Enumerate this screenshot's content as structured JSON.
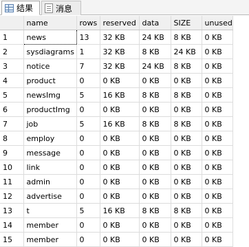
{
  "tabs": [
    {
      "label": "结果",
      "icon": "grid-icon"
    },
    {
      "label": "消息",
      "icon": "document-icon"
    }
  ],
  "columns": [
    "",
    "name",
    "rows",
    "reserved",
    "data",
    "SIZE",
    "unused"
  ],
  "rows": [
    [
      "1",
      "news",
      "13",
      "32 KB",
      "24 KB",
      "8 KB",
      "0 KB"
    ],
    [
      "2",
      "sysdiagrams",
      "1",
      "32 KB",
      "8 KB",
      "24 KB",
      "0 KB"
    ],
    [
      "3",
      "notice",
      "7",
      "32 KB",
      "24 KB",
      "8 KB",
      "0 KB"
    ],
    [
      "4",
      "product",
      "0",
      "0 KB",
      "0 KB",
      "0 KB",
      "0 KB"
    ],
    [
      "5",
      "newsImg",
      "5",
      "16 KB",
      "8 KB",
      "8 KB",
      "0 KB"
    ],
    [
      "6",
      "productImg",
      "0",
      "0 KB",
      "0 KB",
      "0 KB",
      "0 KB"
    ],
    [
      "7",
      "job",
      "5",
      "16 KB",
      "8 KB",
      "8 KB",
      "0 KB"
    ],
    [
      "8",
      "employ",
      "0",
      "0 KB",
      "0 KB",
      "0 KB",
      "0 KB"
    ],
    [
      "9",
      "message",
      "0",
      "0 KB",
      "0 KB",
      "0 KB",
      "0 KB"
    ],
    [
      "10",
      "link",
      "0",
      "0 KB",
      "0 KB",
      "0 KB",
      "0 KB"
    ],
    [
      "11",
      "admin",
      "0",
      "0 KB",
      "0 KB",
      "0 KB",
      "0 KB"
    ],
    [
      "12",
      "advertise",
      "0",
      "0 KB",
      "0 KB",
      "0 KB",
      "0 KB"
    ],
    [
      "13",
      "t",
      "5",
      "16 KB",
      "8 KB",
      "8 KB",
      "0 KB"
    ],
    [
      "14",
      "member",
      "0",
      "0 KB",
      "0 KB",
      "0 KB",
      "0 KB"
    ],
    [
      "15",
      "member",
      "0",
      "0 KB",
      "0 KB",
      "0 KB",
      "0 KB"
    ]
  ],
  "selected_cell": {
    "row": 0,
    "col": 1
  }
}
